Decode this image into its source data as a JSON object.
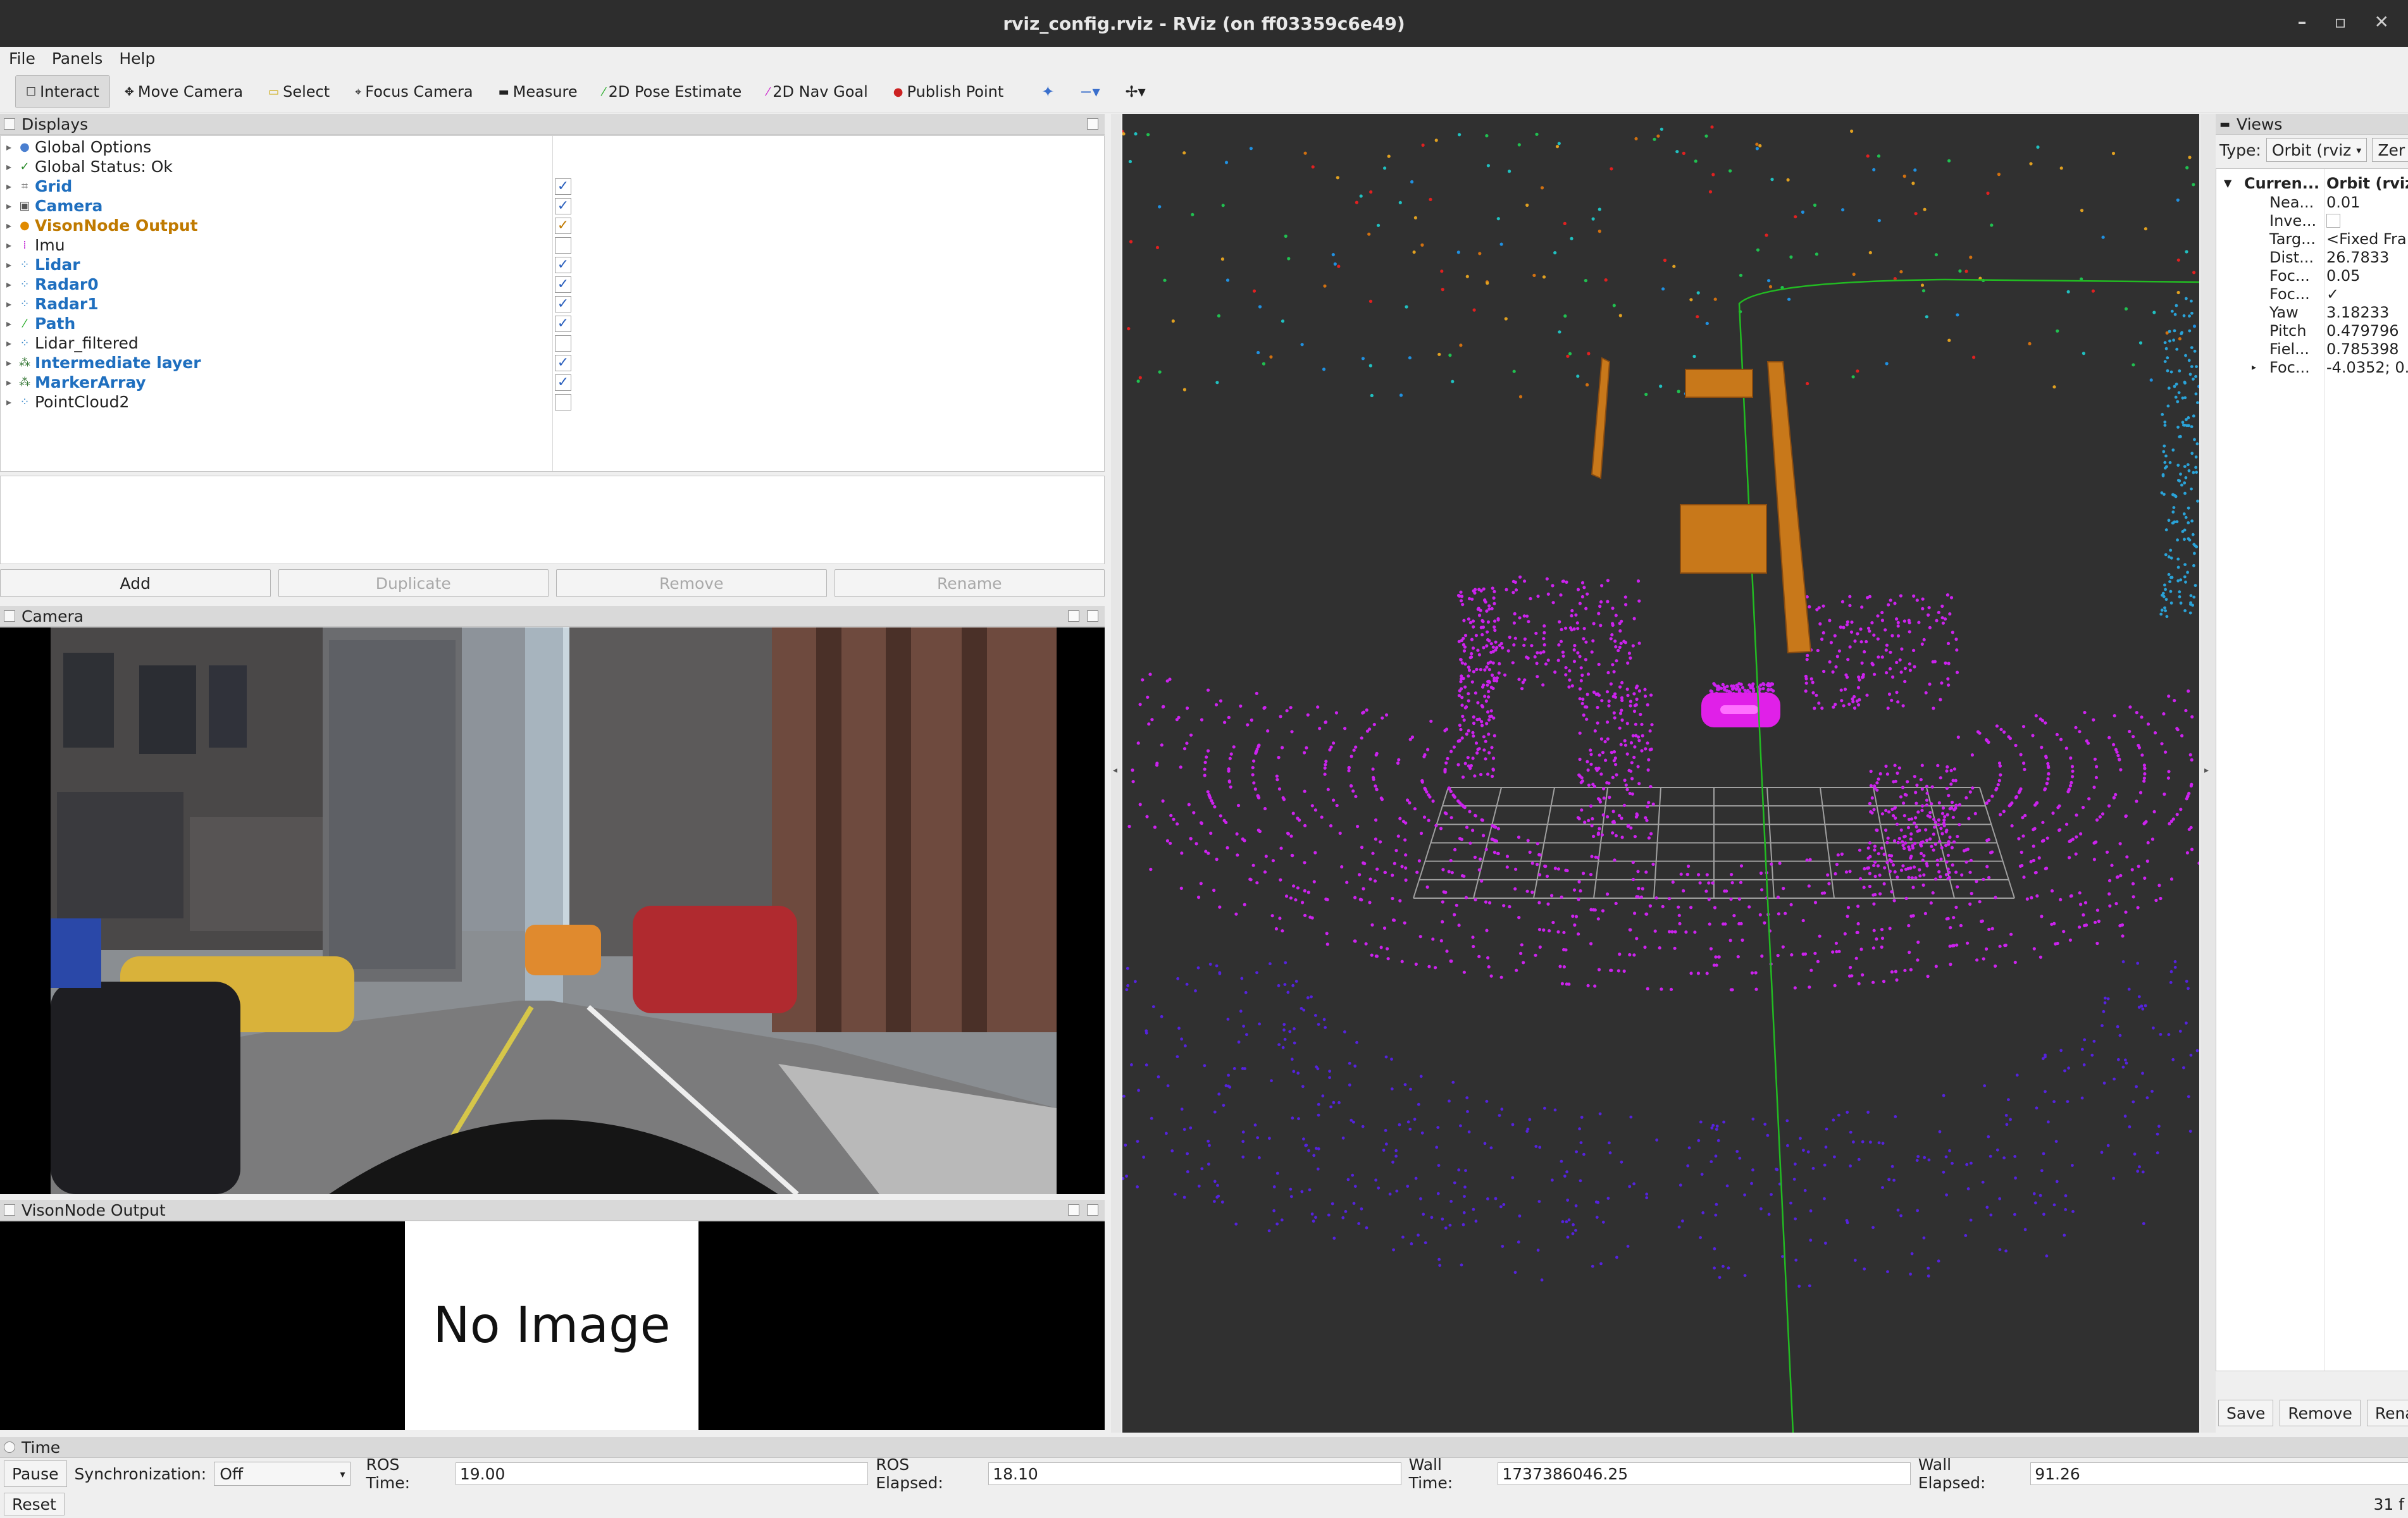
{
  "window": {
    "title": "rviz_config.rviz - RViz (on ff03359c6e49)"
  },
  "menu": [
    "File",
    "Panels",
    "Help"
  ],
  "toolbar": [
    {
      "label": "Interact",
      "icon": "interact-icon",
      "active": true
    },
    {
      "label": "Move Camera",
      "icon": "move-camera-icon"
    },
    {
      "label": "Select",
      "icon": "select-icon"
    },
    {
      "label": "Focus Camera",
      "icon": "focus-camera-icon"
    },
    {
      "label": "Measure",
      "icon": "measure-icon"
    },
    {
      "label": "2D Pose Estimate",
      "icon": "pose-estimate-icon"
    },
    {
      "label": "2D Nav Goal",
      "icon": "nav-goal-icon"
    },
    {
      "label": "Publish Point",
      "icon": "publish-point-icon"
    }
  ],
  "displays": {
    "title": "Displays",
    "items": [
      {
        "label": "Global Options",
        "style": "normal",
        "checkbox": null,
        "icon": "globe-icon"
      },
      {
        "label": "Global Status: Ok",
        "style": "normal",
        "checkbox": null,
        "icon": "check-icon"
      },
      {
        "label": "Grid",
        "style": "bold",
        "checkbox": true,
        "icon": "grid-icon"
      },
      {
        "label": "Camera",
        "style": "bold",
        "checkbox": true,
        "icon": "camera-icon"
      },
      {
        "label": "VisonNode Output",
        "style": "orange",
        "checkbox": true,
        "icon": "image-icon"
      },
      {
        "label": "Imu",
        "style": "normal",
        "checkbox": false,
        "icon": "imu-icon"
      },
      {
        "label": "Lidar",
        "style": "bold",
        "checkbox": true,
        "icon": "pointcloud-icon"
      },
      {
        "label": "Radar0",
        "style": "bold",
        "checkbox": true,
        "icon": "pointcloud-icon"
      },
      {
        "label": "Radar1",
        "style": "bold",
        "checkbox": true,
        "icon": "pointcloud-icon"
      },
      {
        "label": "Path",
        "style": "bold",
        "checkbox": true,
        "icon": "path-icon"
      },
      {
        "label": "Lidar_filtered",
        "style": "normal",
        "checkbox": false,
        "icon": "pointcloud-icon"
      },
      {
        "label": "Intermediate layer",
        "style": "bold",
        "checkbox": true,
        "icon": "marker-icon"
      },
      {
        "label": "MarkerArray",
        "style": "bold",
        "checkbox": true,
        "icon": "marker-icon"
      },
      {
        "label": "PointCloud2",
        "style": "normal",
        "checkbox": false,
        "icon": "pointcloud-icon"
      }
    ],
    "buttons": {
      "add": "Add",
      "duplicate": "Duplicate",
      "remove": "Remove",
      "rename": "Rename"
    }
  },
  "camera_panel": {
    "title": "Camera"
  },
  "vison_panel": {
    "title": "VisonNode Output",
    "placeholder": "No Image"
  },
  "views": {
    "title": "Views",
    "type_label": "Type:",
    "type_value": "Orbit (rviz",
    "zero_label": "Zer",
    "current": {
      "key": "Curren...",
      "value": "Orbit (rviz"
    },
    "props": [
      {
        "key": "Nea...",
        "value": "0.01"
      },
      {
        "key": "Inve...",
        "value": ""
      },
      {
        "key": "Targ...",
        "value": "<Fixed Fra"
      },
      {
        "key": "Dist...",
        "value": "26.7833"
      },
      {
        "key": "Foc...",
        "value": "0.05"
      },
      {
        "key": "Foc...",
        "value": "✓"
      },
      {
        "key": "Yaw",
        "value": "3.18233"
      },
      {
        "key": "Pitch",
        "value": "0.479796"
      },
      {
        "key": "Fiel...",
        "value": "0.785398"
      },
      {
        "key": "Foc...",
        "value": "-4.0352; 0."
      }
    ],
    "buttons": {
      "save": "Save",
      "remove": "Remove",
      "rename": "Renan"
    }
  },
  "time": {
    "title": "Time",
    "pause": "Pause",
    "sync_label": "Synchronization:",
    "sync_value": "Off",
    "ros_time_label": "ROS Time:",
    "ros_time": "19.00",
    "ros_elapsed_label": "ROS Elapsed:",
    "ros_elapsed": "18.10",
    "wall_time_label": "Wall Time:",
    "wall_time": "1737386046.25",
    "wall_elapsed_label": "Wall Elapsed:",
    "wall_elapsed": "91.26",
    "reset": "Reset",
    "fps": "31 f"
  },
  "colors": {
    "lidar": "#cc22ee",
    "radar": "#5522dd",
    "grid": "#a0a0a0",
    "path": "#22bb22",
    "marker": "#c8781a"
  }
}
